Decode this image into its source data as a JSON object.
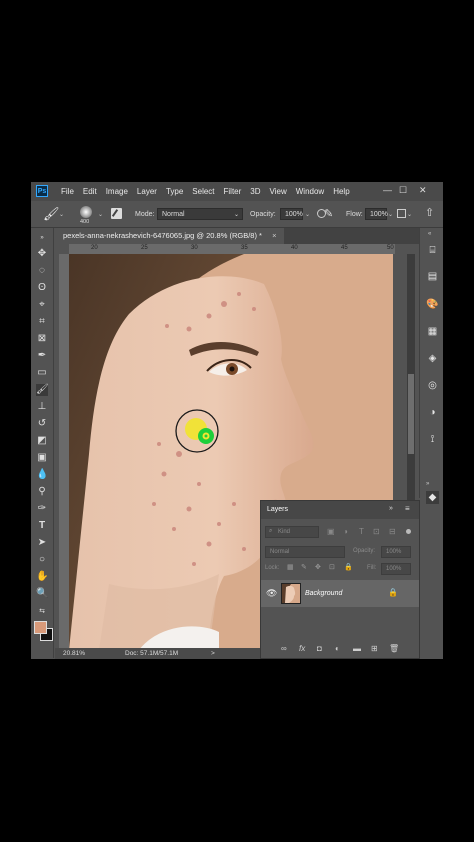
{
  "app": {
    "logo_text": "Ps",
    "menus": [
      "File",
      "Edit",
      "Image",
      "Layer",
      "Type",
      "Select",
      "Filter",
      "3D",
      "View",
      "Window",
      "Help"
    ],
    "window_controls": [
      "—",
      "☐",
      "✕"
    ]
  },
  "options": {
    "brush_size": "400",
    "mode_label": "Mode:",
    "mode_value": "Normal",
    "opacity_label": "Opacity:",
    "opacity_value": "100%",
    "flow_label": "Flow:",
    "flow_value": "100%"
  },
  "document": {
    "tab_title": "pexels-anna-nekrashevich-6476065.jpg @ 20.8% (RGB/8) *",
    "tab_close": "×",
    "ruler_ticks": [
      "20",
      "25",
      "30",
      "35",
      "40",
      "45",
      "50"
    ]
  },
  "status": {
    "zoom": "20.81%",
    "doc": "Doc: 57.1M/57.1M",
    "arrow": ">"
  },
  "layers_panel": {
    "title": "Layers",
    "kind_label": "Kind",
    "blend_mode": "Normal",
    "opacity_label": "Opacity:",
    "opacity_value": "100%",
    "lock_label": "Lock:",
    "fill_label": "Fill:",
    "fill_value": "100%",
    "layer_name": "Background",
    "footer_icons": [
      "∞",
      "fx",
      "◘",
      "◐",
      "▬",
      "⊞",
      "🗑"
    ]
  },
  "colors": {
    "foreground": "#d89a7a",
    "background": "#111111",
    "brush_ring": "#222222",
    "spot_yellow": "#f1e431",
    "cursor_green": "#1ecf3a"
  }
}
